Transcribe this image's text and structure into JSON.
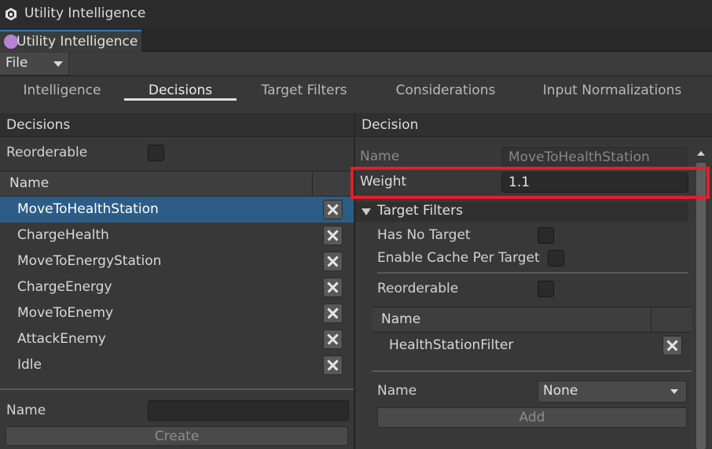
{
  "window": {
    "title": "Utility Intelligence",
    "icon": "unity-cube-icon"
  },
  "tab": {
    "label": "Utility Intelligence"
  },
  "menubar": {
    "file_label": "File"
  },
  "section_tabs": [
    {
      "label": "Intelligence",
      "active": false
    },
    {
      "label": "Decisions",
      "active": true
    },
    {
      "label": "Target Filters",
      "active": false
    },
    {
      "label": "Considerations",
      "active": false
    },
    {
      "label": "Input Normalizations",
      "active": false
    }
  ],
  "left_panel": {
    "header": "Decisions",
    "reorderable_label": "Reorderable",
    "reorderable_checked": false,
    "list_column": "Name",
    "items": [
      {
        "name": "MoveToHealthStation",
        "selected": true
      },
      {
        "name": "ChargeHealth",
        "selected": false
      },
      {
        "name": "MoveToEnergyStation",
        "selected": false
      },
      {
        "name": "ChargeEnergy",
        "selected": false
      },
      {
        "name": "MoveToEnemy",
        "selected": false
      },
      {
        "name": "AttackEnemy",
        "selected": false
      },
      {
        "name": "Idle",
        "selected": false
      }
    ],
    "name_label": "Name",
    "name_value": "",
    "create_label": "Create"
  },
  "right_panel": {
    "header": "Decision",
    "name_label": "Name",
    "name_value": "MoveToHealthStation",
    "weight_label": "Weight",
    "weight_value": "1.1",
    "target_filters": {
      "header": "Target Filters",
      "has_no_target_label": "Has No Target",
      "has_no_target_checked": false,
      "enable_cache_label": "Enable Cache Per Target",
      "enable_cache_checked": false,
      "reorderable_label": "Reorderable",
      "reorderable_checked": false,
      "list_column": "Name",
      "items": [
        {
          "name": "HealthStationFilter"
        }
      ],
      "name_label": "Name",
      "name_select": "None",
      "add_label": "Add"
    }
  },
  "colors": {
    "selection": "#2c5d87",
    "tab_accent": "#3a79bb",
    "highlight": "#e0202a",
    "background": "#383838"
  }
}
